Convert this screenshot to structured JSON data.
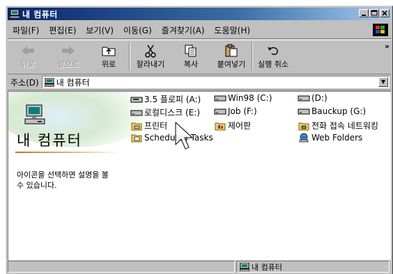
{
  "window": {
    "title": "내 컴퓨터"
  },
  "menu": [
    "파일(F)",
    "편집(E)",
    "보기(V)",
    "이동(G)",
    "즐겨찾기(A)",
    "도움말(H)"
  ],
  "toolbar": {
    "back": "뒤로",
    "forward": "앞으로",
    "up": "위로",
    "cut": "잘라내기",
    "copy": "복사",
    "paste": "붙여넣기",
    "undo": "실행 취소",
    "more": "»"
  },
  "address": {
    "label": "주소(D)",
    "value": "내 컴퓨터"
  },
  "left_pane": {
    "title": "내 컴퓨터",
    "description": "아이콘을 선택하면 설명을 볼 수 있습니다."
  },
  "items": {
    "floppy": "3.5 플로피 (A:)",
    "win98": "Win98 (C:)",
    "d_drive": "(D:)",
    "local_disk": "로컬디스크 (E:)",
    "job": "Job (F:)",
    "backup": "Bauckup (G:)",
    "printers": "프린터",
    "control_panel": "제어판",
    "dialup": "전화 접속 네트워킹",
    "scheduled": "Scheduled Tasks",
    "web_folders": "Web Folders"
  },
  "status": {
    "location": "내 컴퓨터"
  }
}
